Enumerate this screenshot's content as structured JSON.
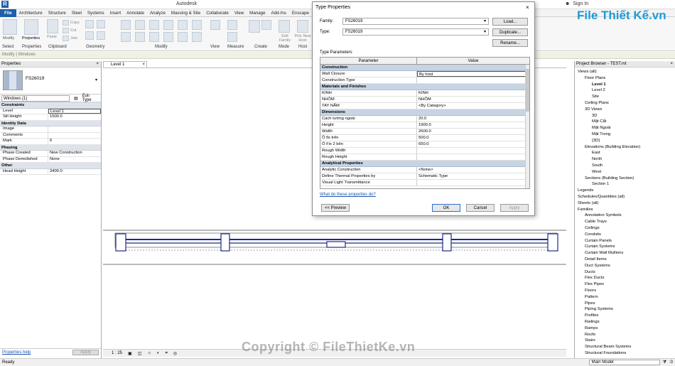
{
  "app": {
    "title": "Autodesk",
    "sign_in": "Sign In"
  },
  "tabs": [
    "File",
    "Architecture",
    "Structure",
    "Steel",
    "Systems",
    "Insert",
    "Annotate",
    "Analyze",
    "Massing & Site",
    "Collaborate",
    "View",
    "Manage",
    "Add-Ins",
    "Enscape"
  ],
  "ribbon": {
    "groups": [
      "Select",
      "Properties",
      "Clipboard",
      "Geometry",
      "Modify",
      "View",
      "Measure",
      "Create",
      "Mode",
      "Host"
    ],
    "buttons": {
      "modify": "Modify",
      "properties": "Properties",
      "paste": "Paste",
      "cut": "Cut",
      "copy": "Copy",
      "join": "Join",
      "edit_family": "Edit Family",
      "pick_new_host": "Pick New Host"
    }
  },
  "option_bar": "Modify | Windows",
  "properties": {
    "title": "Properties",
    "family_name": "FS26019",
    "selector": "Windows (1)",
    "edit_type": "Edit Type",
    "categories": [
      {
        "name": "Constraints",
        "rows": [
          [
            "Level",
            "Level 1"
          ],
          [
            "Sill Height",
            "1500.0"
          ]
        ]
      },
      {
        "name": "Identity Data",
        "rows": [
          [
            "Image",
            ""
          ],
          [
            "Comments",
            ""
          ],
          [
            "Mark",
            "6"
          ]
        ]
      },
      {
        "name": "Phasing",
        "rows": [
          [
            "Phase Created",
            "New Construction"
          ],
          [
            "Phase Demolished",
            "None"
          ]
        ]
      },
      {
        "name": "Other",
        "rows": [
          [
            "Head Height",
            "3400.0"
          ]
        ]
      }
    ],
    "help": "Properties help",
    "apply": "Apply"
  },
  "view": {
    "tab": "Level 1",
    "scale": "1 : 25",
    "model": "Main Model"
  },
  "dialog": {
    "title": "Type Properties",
    "family_label": "Family:",
    "family_value": "FS26019",
    "type_label": "Type:",
    "type_value": "FS26019",
    "load": "Load...",
    "duplicate": "Duplicate...",
    "rename": "Rename...",
    "type_params": "Type Parameters",
    "col_param": "Parameter",
    "col_value": "Value",
    "groups": [
      {
        "name": "Construction",
        "rows": [
          [
            "Wall Closure",
            "By host"
          ],
          [
            "Construction Type",
            ""
          ]
        ]
      },
      {
        "name": "Materials and Finishes",
        "rows": [
          [
            "KINH",
            "KINH"
          ],
          [
            "NHÔM",
            "NHÔM"
          ],
          [
            "TAY NẮM",
            "<By Category>"
          ]
        ]
      },
      {
        "name": "Dimensions",
        "rows": [
          [
            "Cách tường ngoài",
            "20.0"
          ],
          [
            "Height",
            "1900.0"
          ],
          [
            "Width",
            "2600.0"
          ],
          [
            "Ô fix trên",
            "500.0"
          ],
          [
            "Ô Fix 2 bên",
            "650.0"
          ],
          [
            "Rough Width",
            ""
          ],
          [
            "Rough Height",
            ""
          ]
        ]
      },
      {
        "name": "Analytical Properties",
        "rows": [
          [
            "Analytic Construction",
            "<None>"
          ],
          [
            "Define Thermal Properties by",
            "Schematic Type"
          ],
          [
            "Visual Light Transmittance",
            ""
          ]
        ]
      }
    ],
    "help_link": "What do these properties do?",
    "preview": "<< Preview",
    "ok": "OK",
    "cancel": "Cancel",
    "apply": "Apply"
  },
  "browser": {
    "title": "Project Browser - TEST.rvt",
    "items": [
      {
        "t": "Views (all)",
        "d": 0
      },
      {
        "t": "Floor Plans",
        "d": 1
      },
      {
        "t": "Level 1",
        "d": 2,
        "b": true
      },
      {
        "t": "Level 2",
        "d": 2
      },
      {
        "t": "Site",
        "d": 2
      },
      {
        "t": "Ceiling Plans",
        "d": 1
      },
      {
        "t": "3D Views",
        "d": 1
      },
      {
        "t": "3D",
        "d": 2
      },
      {
        "t": "Mặt Cắt",
        "d": 2
      },
      {
        "t": "Mặt Ngoài",
        "d": 2
      },
      {
        "t": "Mặt Trong",
        "d": 2
      },
      {
        "t": "{3D}",
        "d": 2
      },
      {
        "t": "Elevations (Building Elevation)",
        "d": 1
      },
      {
        "t": "East",
        "d": 2
      },
      {
        "t": "North",
        "d": 2
      },
      {
        "t": "South",
        "d": 2
      },
      {
        "t": "West",
        "d": 2
      },
      {
        "t": "Sections (Building Section)",
        "d": 1
      },
      {
        "t": "Section 1",
        "d": 2
      },
      {
        "t": "Legends",
        "d": 0
      },
      {
        "t": "Schedules/Quantities (all)",
        "d": 0
      },
      {
        "t": "Sheets (all)",
        "d": 0
      },
      {
        "t": "Families",
        "d": 0
      },
      {
        "t": "Annotation Symbols",
        "d": 1
      },
      {
        "t": "Cable Trays",
        "d": 1
      },
      {
        "t": "Ceilings",
        "d": 1
      },
      {
        "t": "Conduits",
        "d": 1
      },
      {
        "t": "Curtain Panels",
        "d": 1
      },
      {
        "t": "Curtain Systems",
        "d": 1
      },
      {
        "t": "Curtain Wall Mullions",
        "d": 1
      },
      {
        "t": "Detail Items",
        "d": 1
      },
      {
        "t": "Duct Systems",
        "d": 1
      },
      {
        "t": "Ducts",
        "d": 1
      },
      {
        "t": "Flex Ducts",
        "d": 1
      },
      {
        "t": "Flex Pipes",
        "d": 1
      },
      {
        "t": "Floors",
        "d": 1
      },
      {
        "t": "Pattern",
        "d": 1
      },
      {
        "t": "Pipes",
        "d": 1
      },
      {
        "t": "Piping Systems",
        "d": 1
      },
      {
        "t": "Profiles",
        "d": 1
      },
      {
        "t": "Railings",
        "d": 1
      },
      {
        "t": "Ramps",
        "d": 1
      },
      {
        "t": "Roofs",
        "d": 1
      },
      {
        "t": "Stairs",
        "d": 1
      },
      {
        "t": "Structural Beam Systems",
        "d": 1
      },
      {
        "t": "Structural Foundations",
        "d": 1
      }
    ]
  },
  "status": {
    "left": "Ready",
    "right": ":0"
  },
  "watermark": "Copyright © FileThietKe.vn",
  "logo": "File Thiết Kế.vn"
}
